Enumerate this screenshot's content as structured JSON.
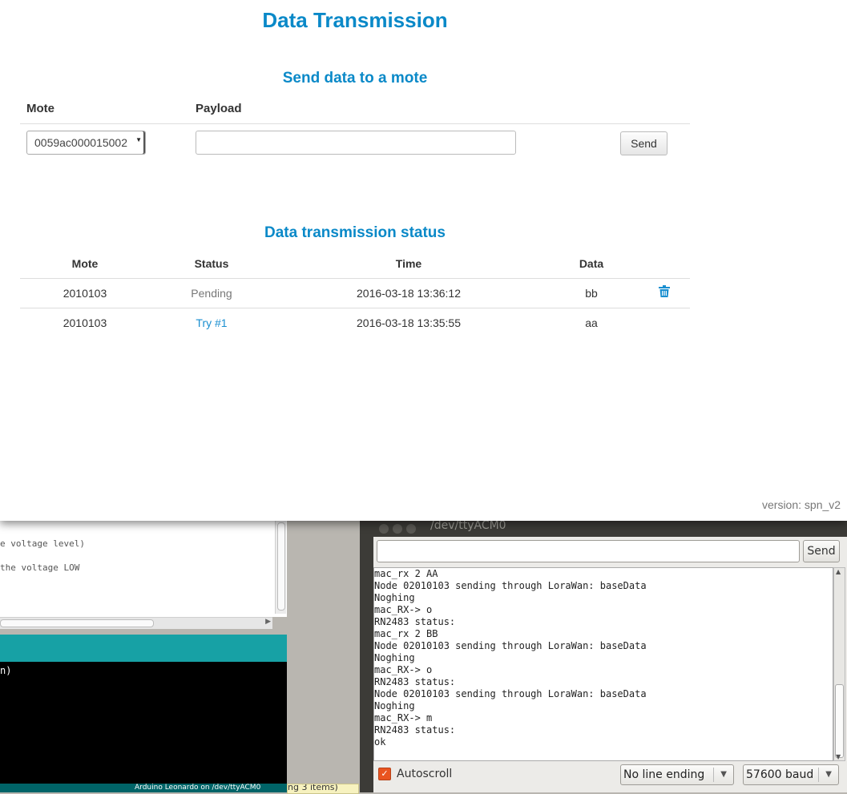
{
  "webpage": {
    "title": "Data Transmission",
    "send_section": {
      "title": "Send data to a mote",
      "mote_header": "Mote",
      "payload_header": "Payload",
      "mote_selected": "0059ac000015002",
      "payload_value": "",
      "send_label": "Send"
    },
    "status_section": {
      "title": "Data transmission status",
      "columns": [
        "Mote",
        "Status",
        "Time",
        "Data"
      ],
      "rows": [
        {
          "mote": "2010103",
          "status": "Pending",
          "time": "2016-03-18 13:36:12",
          "data": "bb"
        },
        {
          "mote": "2010103",
          "status": "Try #1",
          "time": "2016-03-18 13:35:55",
          "data": "aa"
        }
      ]
    },
    "version": "version: spn_v2",
    "colors": {
      "accent": "#0a89c8",
      "link": "#1a8fd0",
      "pending": "#777777"
    }
  },
  "ide": {
    "code_lines": [
      "e voltage level)",
      "the voltage LOW"
    ],
    "console_text": "n)",
    "status_text": "Arduino Leonardo on /dev/ttyACM0",
    "tooltip_text": "ng 3 items)"
  },
  "serial_monitor": {
    "title": "/dev/ttyACM0",
    "send_label": "Send",
    "input_value": "",
    "log": [
      "mac_rx 2 AA",
      "Node 02010103 sending through LoraWan: baseData",
      "Noghing",
      "mac_RX-> o",
      "RN2483 status:",
      "mac_rx 2 BB",
      "Node 02010103 sending through LoraWan: baseData",
      "Noghing",
      "mac_RX-> o",
      "RN2483 status:",
      "Node 02010103 sending through LoraWan: baseData",
      "Noghing",
      "mac_RX-> m",
      "RN2483 status:",
      "ok"
    ],
    "autoscroll_label": "Autoscroll",
    "autoscroll_checked": true,
    "line_ending": "No line ending",
    "baud": "57600 baud"
  }
}
